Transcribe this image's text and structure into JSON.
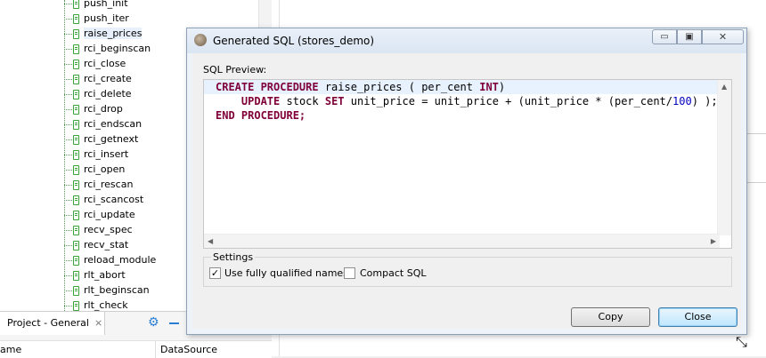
{
  "tree": {
    "items": [
      "push_init",
      "push_iter",
      "raise_prices",
      "rci_beginscan",
      "rci_close",
      "rci_create",
      "rci_delete",
      "rci_drop",
      "rci_endscan",
      "rci_getnext",
      "rci_insert",
      "rci_open",
      "rci_rescan",
      "rci_scancost",
      "rci_update",
      "recv_spec",
      "recv_stat",
      "reload_module",
      "rlt_abort",
      "rlt_beginscan",
      "rlt_check"
    ],
    "selected_index": 2
  },
  "bottom_panel": {
    "tab_label": "Project - General",
    "tab_close": "⨯",
    "gear_icon": "gear-icon",
    "col_name": "ame",
    "col_datasource": "DataSource"
  },
  "dialog": {
    "title": "Generated SQL (stores_demo)",
    "min_glyph": "▭",
    "max_glyph": "▣",
    "close_glyph": "✕",
    "preview_label": "SQL Preview:",
    "code": {
      "line1_kw1": "CREATE PROCEDURE",
      "line1_rest": " raise_prices ( per_cent ",
      "line1_kw2": "INT",
      "line1_end": ")",
      "line2_indent": "    ",
      "line2_kw1": "UPDATE",
      "line2_mid": " stock ",
      "line2_kw2": "SET",
      "line2_rest": " unit_price = unit_price + (unit_price * (per_cent/",
      "line2_num": "100",
      "line2_end": ") );",
      "line3_kw": "END PROCEDURE;"
    },
    "settings_legend": "Settings",
    "checkbox_fq_label": "Use fully qualified names",
    "checkbox_fq_checked": "✓",
    "checkbox_compact_label": "Compact SQL",
    "copy_label": "Copy",
    "close_label": "Close"
  }
}
